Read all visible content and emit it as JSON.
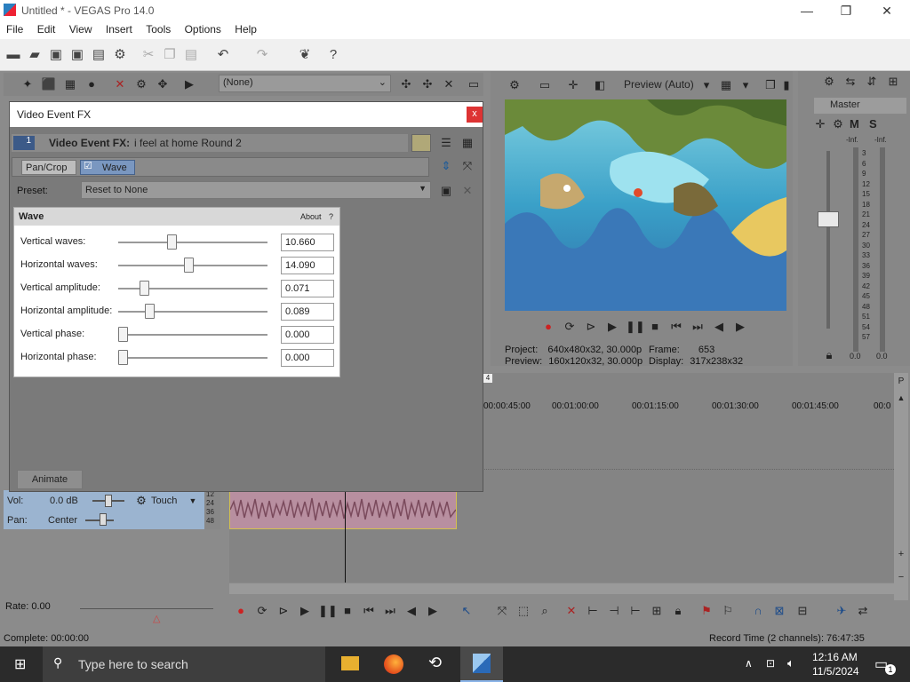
{
  "window": {
    "title": "Untitled * - VEGAS Pro 14.0",
    "minimize": "—",
    "maximize": "❐",
    "close": "✕"
  },
  "menu": [
    "File",
    "Edit",
    "View",
    "Insert",
    "Tools",
    "Options",
    "Help"
  ],
  "toolbar_icons": [
    "new-icon",
    "open-icon",
    "save-icon",
    "save-as-icon",
    "render-icon",
    "properties-icon",
    "cut-icon",
    "copy-icon",
    "paste-icon",
    "undo-icon",
    "redo-icon",
    "plugin-icon",
    "help-icon"
  ],
  "explorer_toolbar": {
    "dropdown_value": "(None)"
  },
  "preview": {
    "quality": "Preview (Auto)",
    "project_label": "Project:",
    "project_value": "640x480x32, 30.000p",
    "preview_label": "Preview:",
    "preview_value": "160x120x32, 30.000p",
    "frame_label": "Frame:",
    "frame_value": "653",
    "display_label": "Display:",
    "display_value": "317x238x32"
  },
  "mixer": {
    "title": "Master",
    "mute": "M",
    "solo": "S",
    "inf_left": "-Inf.",
    "inf_right": "-Inf.",
    "scale": [
      "3",
      "6",
      "9",
      "12",
      "15",
      "18",
      "21",
      "24",
      "27",
      "30",
      "33",
      "36",
      "39",
      "42",
      "45",
      "48",
      "51",
      "54",
      "57"
    ],
    "bottom_left": "0.0",
    "bottom_right": "0.0"
  },
  "timeline": {
    "ticks": [
      "00:00:45:00",
      "00:01:00:00",
      "00:01:15:00",
      "00:01:30:00",
      "00:01:45:00",
      "00:0"
    ],
    "marker": "4",
    "track": {
      "vol_label": "Vol:",
      "vol_value": "0.0 dB",
      "pan_label": "Pan:",
      "pan_value": "Center",
      "automation": "Touch",
      "meter_marks": [
        "12",
        "24",
        "36",
        "48"
      ]
    },
    "rate": "Rate: 0.00"
  },
  "status": {
    "complete": "Complete: 00:00:00",
    "record_time": "Record Time (2 channels): 76:47:35"
  },
  "fx_dialog": {
    "title": "Video Event FX",
    "close": "x",
    "chain_index": "1",
    "heading_label": "Video Event FX:",
    "heading_value": "i feel at home Round 2",
    "chain": [
      "Pan/Crop",
      "Wave"
    ],
    "preset_label": "Preset:",
    "preset_value": "Reset to None",
    "panel_title": "Wave",
    "about": "About",
    "about_q": "?",
    "params": [
      {
        "label": "Vertical waves:",
        "value": "10.660",
        "fraction": 0.33
      },
      {
        "label": "Horizontal waves:",
        "value": "14.090",
        "fraction": 0.44
      },
      {
        "label": "Vertical amplitude:",
        "value": "0.071",
        "fraction": 0.14
      },
      {
        "label": "Horizontal amplitude:",
        "value": "0.089",
        "fraction": 0.18
      },
      {
        "label": "Vertical phase:",
        "value": "0.000",
        "fraction": 0.0
      },
      {
        "label": "Horizontal phase:",
        "value": "0.000",
        "fraction": 0.0
      }
    ],
    "animate": "Animate"
  },
  "taskbar": {
    "search_placeholder": "Type here to search",
    "time": "12:16 AM",
    "date": "11/5/2024",
    "notification_count": "1"
  }
}
